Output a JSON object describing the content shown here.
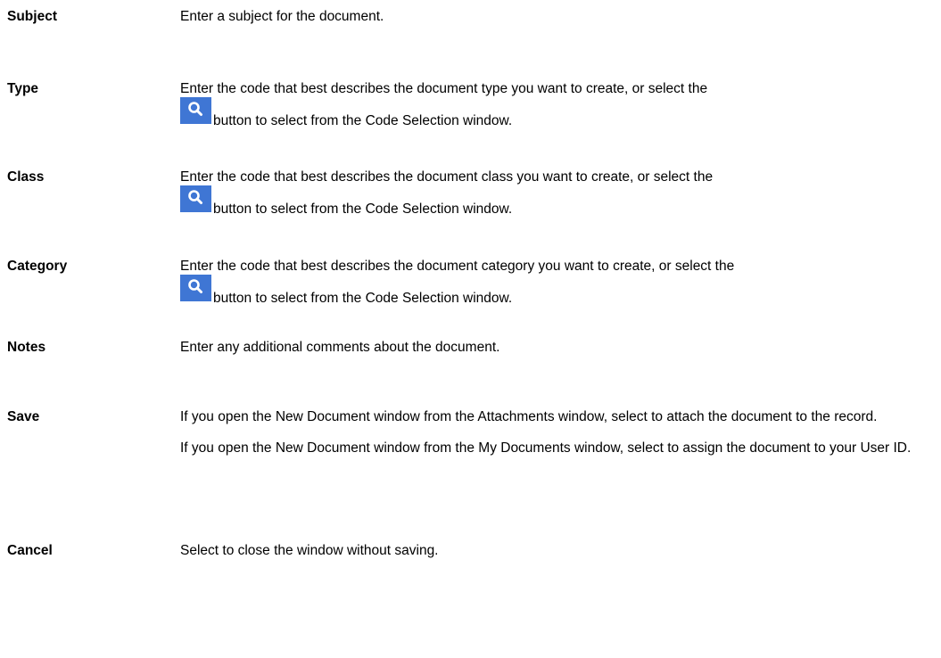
{
  "rows": {
    "subject": {
      "term": "Subject",
      "desc": "Enter a subject for the document."
    },
    "type": {
      "term": "Type",
      "desc_before": "Enter the code that best describes the document type you want to create, or select the",
      "desc_after": "button to select from the Code Selection window."
    },
    "class": {
      "term": "Class",
      "desc_before": "Enter the code that best describes the document class you want to create, or select the",
      "desc_after": "button to select from the Code Selection window."
    },
    "category": {
      "term": "Category",
      "desc_before": "Enter the code that best describes the document category you want to create, or select the",
      "desc_after": "button to select from the Code Selection window."
    },
    "notes": {
      "term": "Notes",
      "desc": "Enter any additional comments about the document."
    },
    "save": {
      "term": "Save",
      "para1": "If you open the New Document window from the Attachments window, select to attach the document to the record.",
      "para2": "If you open the New Document window from the My Documents window, select to assign the document to your User ID."
    },
    "cancel": {
      "term": "Cancel",
      "desc": "Select to close the window without saving."
    }
  },
  "icons": {
    "search_button_icon": "search-icon",
    "search_button_color": "#3f76d4"
  }
}
